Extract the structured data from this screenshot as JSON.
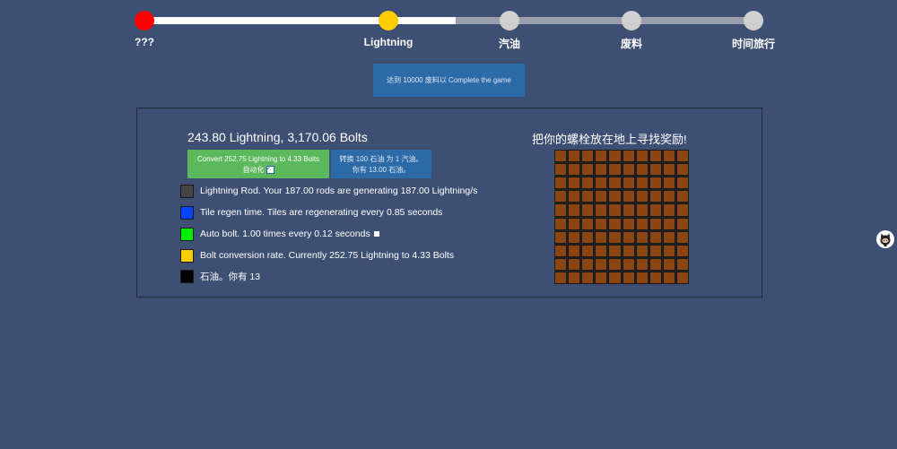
{
  "stepper": {
    "steps": [
      {
        "label": "???",
        "color": "#ff0000",
        "state": "done"
      },
      {
        "label": "Lightning",
        "color": "#ffcc00",
        "state": "current"
      },
      {
        "label": "汽油",
        "color": "#cfcfcf",
        "state": "locked"
      },
      {
        "label": "废料",
        "color": "#cfcfcf",
        "state": "locked"
      },
      {
        "label": "时间旅行",
        "color": "#cfcfcf",
        "state": "locked"
      }
    ]
  },
  "goal": {
    "label": "达到 10000 废料以 Complete the game"
  },
  "status": {
    "title": "243.80 Lightning, 3,170.06 Bolts"
  },
  "convert": {
    "label": "Convert 252.75 Lightning to 4.33 Bolts",
    "auto_label": "自动化",
    "auto_checked": true
  },
  "oil": {
    "line1": "转换 100 石油 为 1 汽油。",
    "line2": "你有 13.00 石油。"
  },
  "upgrades": [
    {
      "color": "#444444",
      "text": "Lightning Rod. Your 187.00 rods are generating 187.00 Lightning/s"
    },
    {
      "color": "#0044ff",
      "text": "Tile regen time. Tiles are regenerating every 0.85 seconds"
    },
    {
      "color": "#00ee00",
      "text": "Auto bolt. 1.00 times every 0.12 seconds",
      "has_toggle": true
    },
    {
      "color": "#ffcc00",
      "text": "Bolt conversion rate. Currently 252.75 Lightning to 4.33 Bolts"
    },
    {
      "color": "#000000",
      "text": "石油。你有 13"
    }
  ],
  "grid": {
    "title": "把你的螺栓放在地上寻找奖励!",
    "rows": 10,
    "cols": 10,
    "tile_color": "#8b4513"
  },
  "side": {
    "icon": "octocat-icon"
  }
}
